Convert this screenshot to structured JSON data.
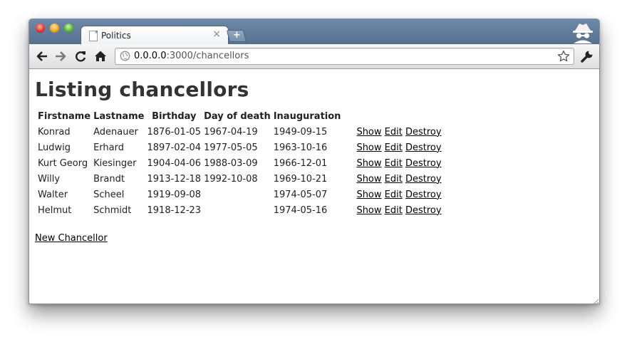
{
  "browser": {
    "tab": {
      "title": "Politics",
      "close_glyph": "×"
    },
    "new_tab_glyph": "+",
    "address": {
      "host": "0.0.0.0",
      "rest": ":3000/chancellors"
    }
  },
  "page": {
    "heading": "Listing chancellors",
    "columns": [
      "Firstname",
      "Lastname",
      "Birthday",
      "Day of death",
      "Inauguration"
    ],
    "rows": [
      {
        "firstname": "Konrad",
        "lastname": "Adenauer",
        "birthday": "1876-01-05",
        "death": "1967-04-19",
        "inauguration": "1949-09-15"
      },
      {
        "firstname": "Ludwig",
        "lastname": "Erhard",
        "birthday": "1897-02-04",
        "death": "1977-05-05",
        "inauguration": "1963-10-16"
      },
      {
        "firstname": "Kurt Georg",
        "lastname": "Kiesinger",
        "birthday": "1904-04-06",
        "death": "1988-03-09",
        "inauguration": "1966-12-01"
      },
      {
        "firstname": "Willy",
        "lastname": "Brandt",
        "birthday": "1913-12-18",
        "death": "1992-10-08",
        "inauguration": "1969-10-21"
      },
      {
        "firstname": "Walter",
        "lastname": "Scheel",
        "birthday": "1919-09-08",
        "death": "",
        "inauguration": "1974-05-07"
      },
      {
        "firstname": "Helmut",
        "lastname": "Schmidt",
        "birthday": "1918-12-23",
        "death": "",
        "inauguration": "1974-05-16"
      }
    ],
    "actions": {
      "show": "Show",
      "edit": "Edit",
      "destroy": "Destroy"
    },
    "new_link": "New Chancellor"
  },
  "icons": {
    "traffic_lights": [
      "close-traffic-light",
      "minimize-traffic-light",
      "zoom-traffic-light"
    ],
    "tab": "page-icon",
    "toolbar": [
      "back-arrow-icon",
      "forward-arrow-icon",
      "reload-icon",
      "home-icon",
      "globe-icon",
      "star-icon",
      "wrench-icon"
    ],
    "profile": "incognito-icon"
  }
}
